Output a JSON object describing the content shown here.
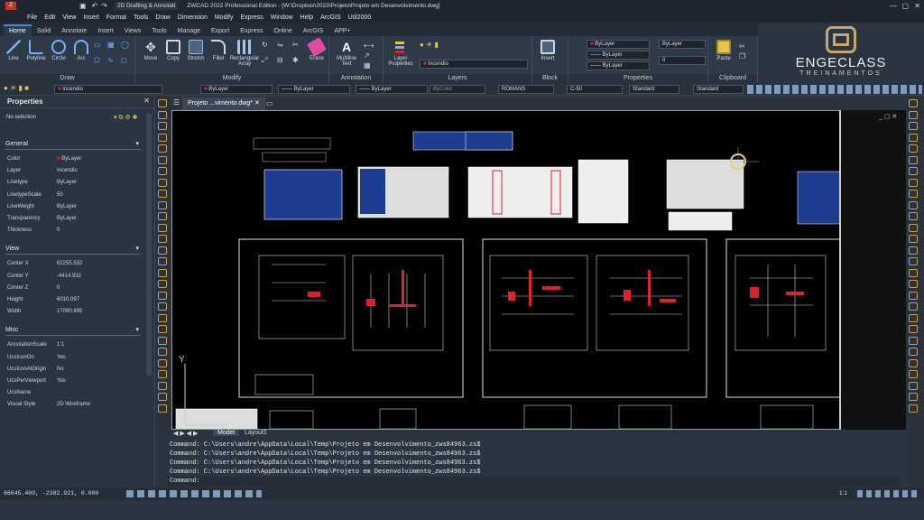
{
  "title_bar": {
    "workspace": "2D Drafting & Annotati",
    "title": "ZWCAD 2022 Professional Edition - [W:\\Dropbox\\2023\\Projeto\\Projeto em Desenvolvimento.dwg]"
  },
  "menu": [
    "File",
    "Edit",
    "View",
    "Insert",
    "Format",
    "Tools",
    "Draw",
    "Dimension",
    "Modify",
    "Express",
    "Window",
    "Help",
    "ArcGIS",
    "Util2000"
  ],
  "ribbon_tabs": [
    "Home",
    "Solid",
    "Annotate",
    "Insert",
    "Views",
    "Tools",
    "Manage",
    "Export",
    "Express",
    "Online",
    "ArcGIS",
    "APP+"
  ],
  "ribbon": {
    "draw_tools": [
      "Line",
      "Polyline",
      "Circle",
      "Arc"
    ],
    "modify_tools": [
      "Move",
      "Copy",
      "Stretch",
      "Fillet",
      "Rectangular Array"
    ],
    "erase": "Erase",
    "multiline_text": "Multiline Text",
    "layer_properties": "Layer Properties",
    "insert": "Insert",
    "paste": "Paste",
    "layer_current": "Incendio",
    "byLayer": "ByLayer",
    "lineweight_value": "0",
    "panels": [
      "Draw",
      "Modify",
      "Annotation",
      "Layers",
      "Block",
      "Properties",
      "Clipboard"
    ]
  },
  "logo": {
    "name": "ENGECLASS",
    "tagline": "TREINAMENTOS"
  },
  "toolbar2": {
    "layer": "Incendio",
    "color": "ByLayer",
    "linetype": "ByLayer",
    "lineweight": "ByLayer",
    "plotstyle": "ByColor",
    "textstyle": "ROMANS",
    "dimstyle": "C-50",
    "tablestyle": "Standard",
    "mleaderstyle": "Standard"
  },
  "properties": {
    "header": "Properties",
    "selection": "No selection",
    "sections": {
      "general": "General",
      "view": "View",
      "misc": "Misc"
    },
    "general": [
      {
        "k": "Color",
        "v": "ByLayer"
      },
      {
        "k": "Layer",
        "v": "Incendio"
      },
      {
        "k": "Linetype",
        "v": "ByLayer"
      },
      {
        "k": "LinetypeScale",
        "v": "50"
      },
      {
        "k": "LineWeight",
        "v": "ByLayer"
      },
      {
        "k": "Transparency",
        "v": "ByLayer"
      },
      {
        "k": "Thickness",
        "v": "0"
      }
    ],
    "view": [
      {
        "k": "Center X",
        "v": "62255.532"
      },
      {
        "k": "Center Y",
        "v": "-4414.932"
      },
      {
        "k": "Center Z",
        "v": "0"
      },
      {
        "k": "Height",
        "v": "6010.097"
      },
      {
        "k": "Width",
        "v": "17090.995"
      }
    ],
    "misc": [
      {
        "k": "AnnotationScale",
        "v": "1:1"
      },
      {
        "k": "UcsIconOn",
        "v": "Yes"
      },
      {
        "k": "UcsIconAtOrigin",
        "v": "No"
      },
      {
        "k": "UcsPerViewport",
        "v": "Yes"
      },
      {
        "k": "UcsName",
        "v": ""
      },
      {
        "k": "Visual Style",
        "v": "2D Wireframe"
      }
    ]
  },
  "doc_tab": "Projeto ...vimento.dwg*",
  "model_tabs": [
    "Model",
    "Layout1"
  ],
  "commands": [
    "Command: C:\\Users\\andre\\AppData\\Local\\Temp\\Projeto em Desenvolvimento_zws84963.zs$",
    "Command: C:\\Users\\andre\\AppData\\Local\\Temp\\Projeto em Desenvolvimento_zws84963.zs$",
    "Command: C:\\Users\\andre\\AppData\\Local\\Temp\\Projeto em Desenvolvimento_zws84963.zs$",
    "Command: C:\\Users\\andre\\AppData\\Local\\Temp\\Projeto em Desenvolvimento_zws84963.zs$"
  ],
  "command_prompt": "Command:",
  "coords": "66645.400, -2382.921, 0.000",
  "scale": "1:1",
  "colors": {
    "accent": "#3a8ee6",
    "red": "#e0202a",
    "dark": "#2b3441"
  }
}
